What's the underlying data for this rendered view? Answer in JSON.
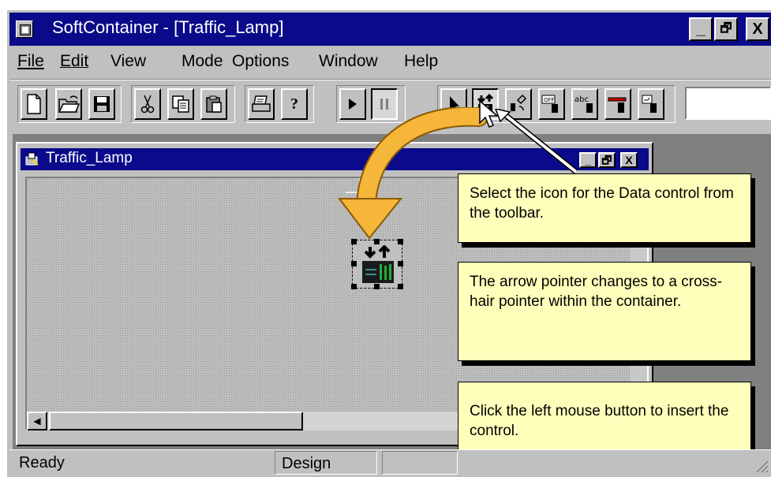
{
  "window": {
    "title": "SoftContainer - [Traffic_Lamp]",
    "minimize_label": "_",
    "restore_label": "🗗",
    "close_label": "X"
  },
  "menu": {
    "items": [
      {
        "label": "File"
      },
      {
        "label": "Edit"
      },
      {
        "label": "View"
      },
      {
        "label": "Mode"
      },
      {
        "label": "Options"
      },
      {
        "label": "Window"
      },
      {
        "label": "Help"
      }
    ]
  },
  "toolbar": {
    "buttons": [
      {
        "icon": "new-document-icon"
      },
      {
        "icon": "open-folder-icon"
      },
      {
        "icon": "save-disk-icon"
      },
      {
        "icon": "cut-scissors-icon"
      },
      {
        "icon": "copy-icon"
      },
      {
        "icon": "paste-clipboard-icon"
      },
      {
        "icon": "print-icon"
      },
      {
        "icon": "help-question-icon",
        "label": "?"
      },
      {
        "icon": "play-icon"
      },
      {
        "icon": "pause-icon"
      },
      {
        "icon": "arrow-pointer-icon"
      },
      {
        "icon": "data-control-icon",
        "selected": true
      },
      {
        "icon": "switch-control-icon"
      },
      {
        "icon": "off-button-control-icon",
        "label": "OFF"
      },
      {
        "icon": "text-control-icon",
        "label": "abc"
      },
      {
        "icon": "slider-control-icon"
      },
      {
        "icon": "display-control-icon"
      }
    ]
  },
  "child_window": {
    "title": "Traffic_Lamp"
  },
  "callouts": [
    {
      "text": "Select the icon for the Data control from the toolbar."
    },
    {
      "text": "The arrow pointer changes to a cross-hair pointer within the container."
    },
    {
      "text": "Click the left mouse button to insert the control."
    }
  ],
  "status": {
    "ready": "Ready",
    "mode": "Design"
  },
  "colors": {
    "titlebar": "#0a0a8a",
    "window_face": "#c0c0c0",
    "callout_bg": "#ffffbb",
    "arrow_orange": "#f5b63a"
  }
}
